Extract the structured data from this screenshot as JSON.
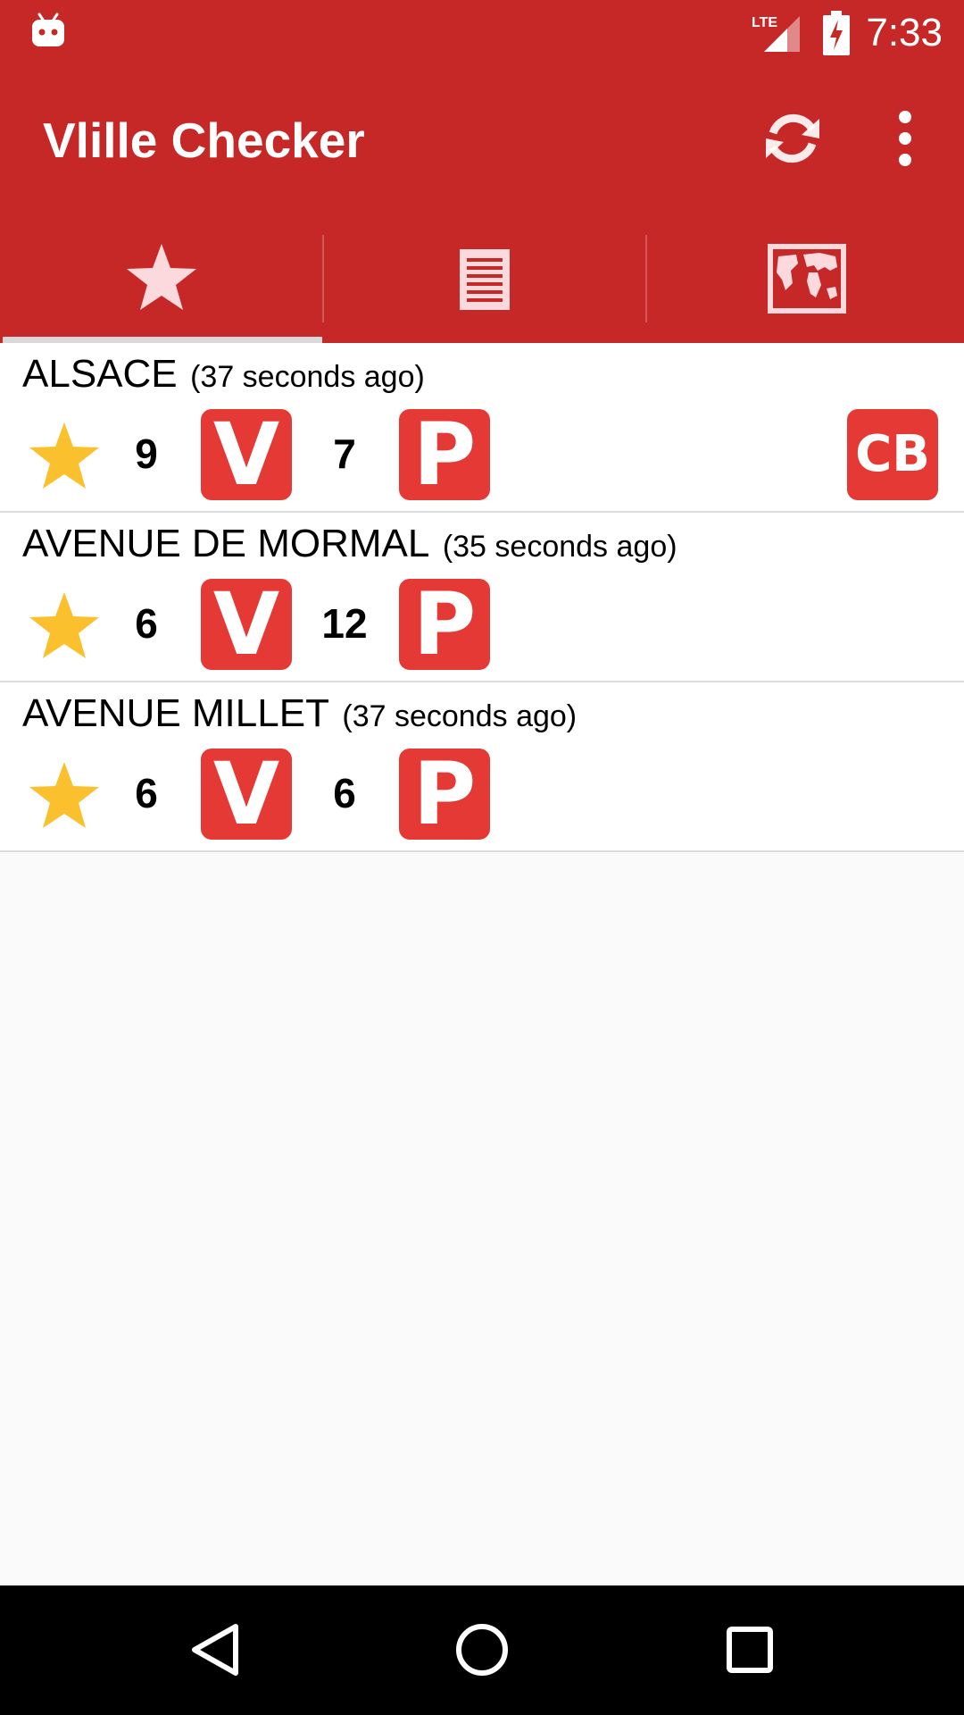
{
  "status_bar": {
    "time": "7:33",
    "network": "LTE",
    "icons": [
      "android-notification-icon",
      "lte-signal-icon",
      "battery-charging-icon"
    ]
  },
  "toolbar": {
    "title": "Vlille Checker",
    "refresh_icon": "refresh-icon",
    "overflow_icon": "more-vert-icon"
  },
  "tabs": [
    {
      "icon": "star-icon",
      "selected": true
    },
    {
      "icon": "list-icon",
      "selected": false
    },
    {
      "icon": "map-icon",
      "selected": false
    }
  ],
  "stations": [
    {
      "name": "ALSACE",
      "updated": "(37 seconds ago)",
      "bikes": "9",
      "bikes_badge": "V",
      "places": "7",
      "places_badge": "P",
      "cb": "CB",
      "favorite": true
    },
    {
      "name": "AVENUE DE MORMAL",
      "updated": "(35 seconds ago)",
      "bikes": "6",
      "bikes_badge": "V",
      "places": "12",
      "places_badge": "P",
      "favorite": true
    },
    {
      "name": "AVENUE MILLET",
      "updated": "(37 seconds ago)",
      "bikes": "6",
      "bikes_badge": "V",
      "places": "6",
      "places_badge": "P",
      "favorite": true
    }
  ],
  "colors": {
    "primary": "#c62828",
    "badge": "#e53935",
    "star": "#fbc02d",
    "background": "#fafafa"
  },
  "nav_bar": {
    "icons": [
      "back-icon",
      "home-icon",
      "recents-icon"
    ]
  }
}
